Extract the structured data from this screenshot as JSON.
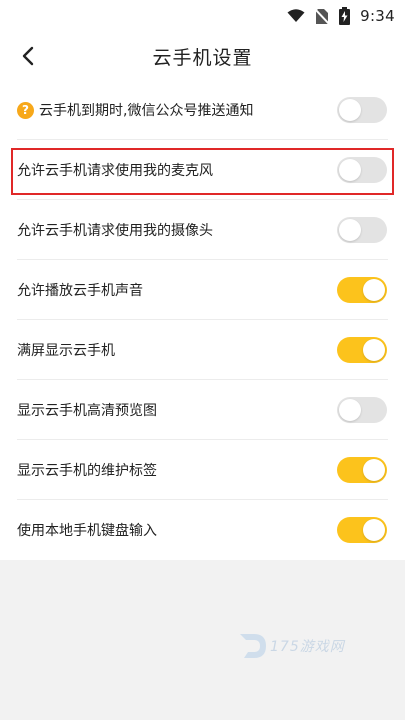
{
  "status_bar": {
    "time": "9:34",
    "icons": [
      "wifi-icon",
      "no-sim-icon",
      "battery-charging-icon"
    ]
  },
  "header": {
    "title": "云手机设置",
    "back_icon": "chevron-left-icon"
  },
  "settings": [
    {
      "label": "云手机到期时,微信公众号推送通知",
      "enabled": false,
      "has_help": true
    },
    {
      "label": "允许云手机请求使用我的麦克风",
      "enabled": false,
      "highlighted": true
    },
    {
      "label": "允许云手机请求使用我的摄像头",
      "enabled": false
    },
    {
      "label": "允许播放云手机声音",
      "enabled": true
    },
    {
      "label": "满屏显示云手机",
      "enabled": true
    },
    {
      "label": "显示云手机高清预览图",
      "enabled": false
    },
    {
      "label": "显示云手机的维护标签",
      "enabled": true
    },
    {
      "label": "使用本地手机键盘输入",
      "enabled": true
    }
  ],
  "help_icon": {
    "glyph": "?"
  },
  "watermark": {
    "text": "175游戏网"
  },
  "colors": {
    "accent": "#fcc31c",
    "toggle_off": "#e3e3e3",
    "highlight": "#e02828",
    "help": "#f7a81a"
  }
}
